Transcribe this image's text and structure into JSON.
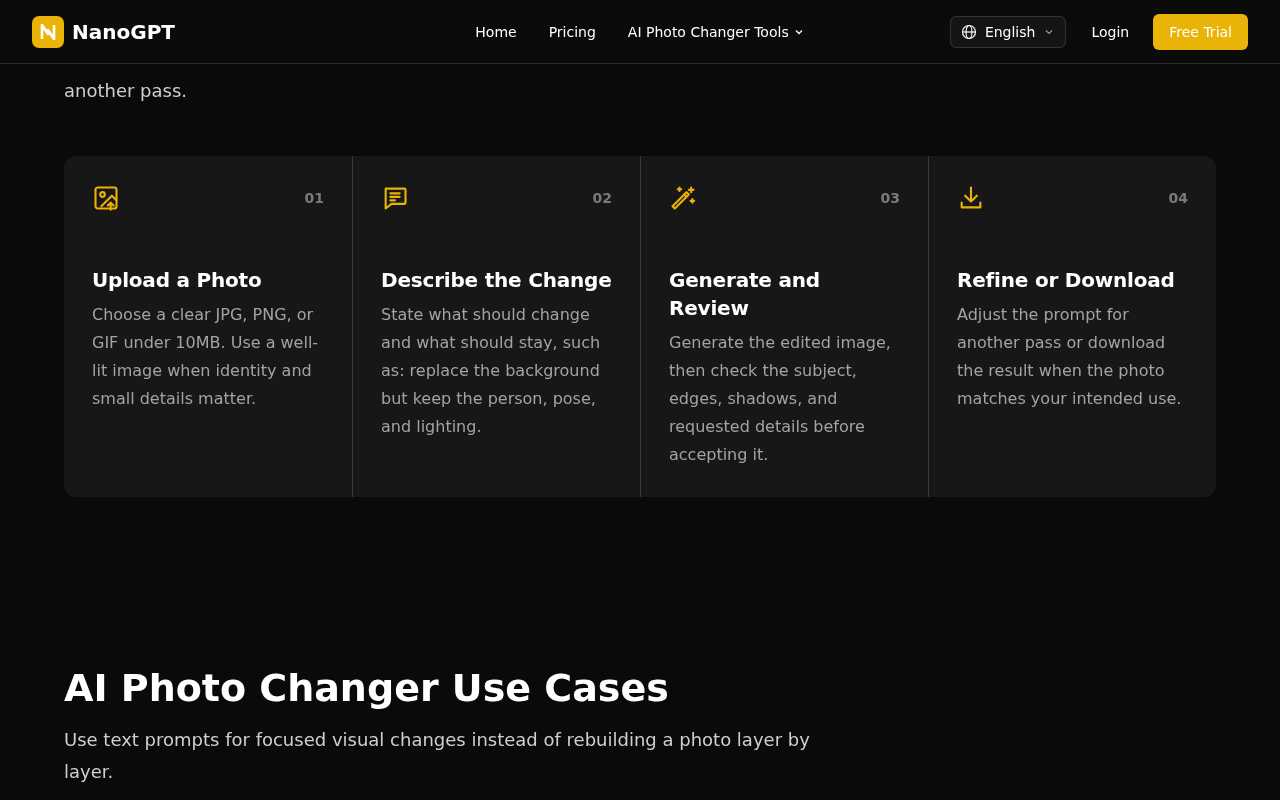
{
  "header": {
    "brand": "NanoGPT",
    "nav": [
      {
        "label": "Home",
        "kind": "link"
      },
      {
        "label": "Pricing",
        "kind": "link"
      },
      {
        "label": "AI Photo Changer Tools",
        "kind": "dropdown"
      }
    ],
    "language": "English",
    "login": "Login",
    "cta": "Free Trial"
  },
  "intro_tail": "another pass.",
  "steps": [
    {
      "number": "01",
      "title": "Upload a Photo",
      "text": "Choose a clear JPG, PNG, or GIF under 10MB. Use a well-lit image when identity and small details matter."
    },
    {
      "number": "02",
      "title": "Describe the Change",
      "text": "State what should change and what should stay, such as: replace the background but keep the person, pose, and lighting."
    },
    {
      "number": "03",
      "title": "Generate and Review",
      "text": "Generate the edited image, then check the subject, edges, shadows, and requested details before accepting it."
    },
    {
      "number": "04",
      "title": "Refine or Download",
      "text": "Adjust the prompt for another pass or download the result when the photo matches your intended use."
    }
  ],
  "use_cases": {
    "title": "AI Photo Changer Use Cases",
    "text": "Use text prompts for focused visual changes instead of rebuilding a photo layer by layer."
  }
}
